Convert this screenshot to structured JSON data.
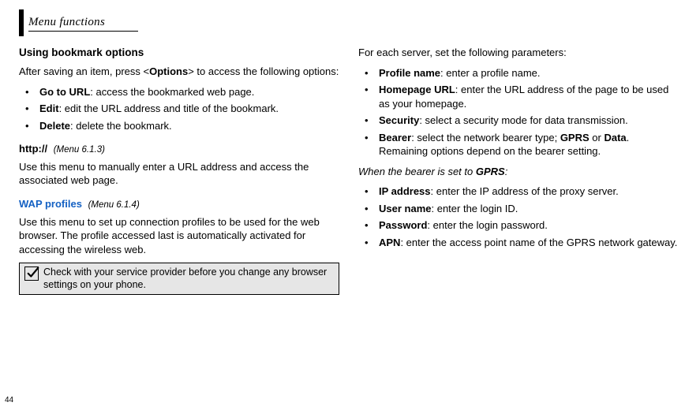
{
  "header": {
    "tab_label": "Menu functions",
    "page_number": "44"
  },
  "left": {
    "sec1_title": "Using bookmark options",
    "sec1_intro_pre": "After saving an item, press <",
    "sec1_intro_bold": "Options",
    "sec1_intro_post": "> to access the following options:",
    "items": [
      {
        "term": "Go to URL",
        "desc": ": access the bookmarked web page."
      },
      {
        "term": "Edit",
        "desc": ": edit the URL address and title of the bookmark."
      },
      {
        "term": "Delete",
        "desc": ": delete the bookmark."
      }
    ],
    "http_lead": "http://",
    "http_ref": "(Menu 6.1.3)",
    "http_desc": "Use this menu to manually enter a URL address and access the associated web page.",
    "wap_lead": "WAP profiles",
    "wap_ref": "(Menu 6.1.4)",
    "wap_desc": "Use this menu to set up connection profiles to be used for the web browser. The profile accessed last is automatically activated for accessing the wireless web.",
    "note": "Check with your service provider before you change any browser settings on your phone."
  },
  "right": {
    "intro": "For each server, set the following parameters:",
    "items1": [
      {
        "term": "Profile name",
        "desc": ": enter a profile name."
      },
      {
        "term": "Homepage URL",
        "desc": ": enter the URL address of the page to be used as your homepage."
      },
      {
        "term": "Security",
        "desc": ": select a security mode for data transmission."
      }
    ],
    "bearer_term": "Bearer",
    "bearer_pre": ": select the network bearer type; ",
    "bearer_opt1": "GPRS",
    "bearer_mid": " or ",
    "bearer_opt2": "Data",
    "bearer_post": ". Remaining options depend on the bearer setting.",
    "when_pre": "When the bearer is set to ",
    "when_bold": "GPRS",
    "when_post": ":",
    "items2": [
      {
        "term": "IP address",
        "desc": ": enter the IP address of the proxy server."
      },
      {
        "term": "User name",
        "desc": ": enter the login ID."
      },
      {
        "term": "Password",
        "desc": ": enter the login password."
      },
      {
        "term": "APN",
        "desc": ": enter the access point name of the GPRS network gateway."
      }
    ]
  }
}
